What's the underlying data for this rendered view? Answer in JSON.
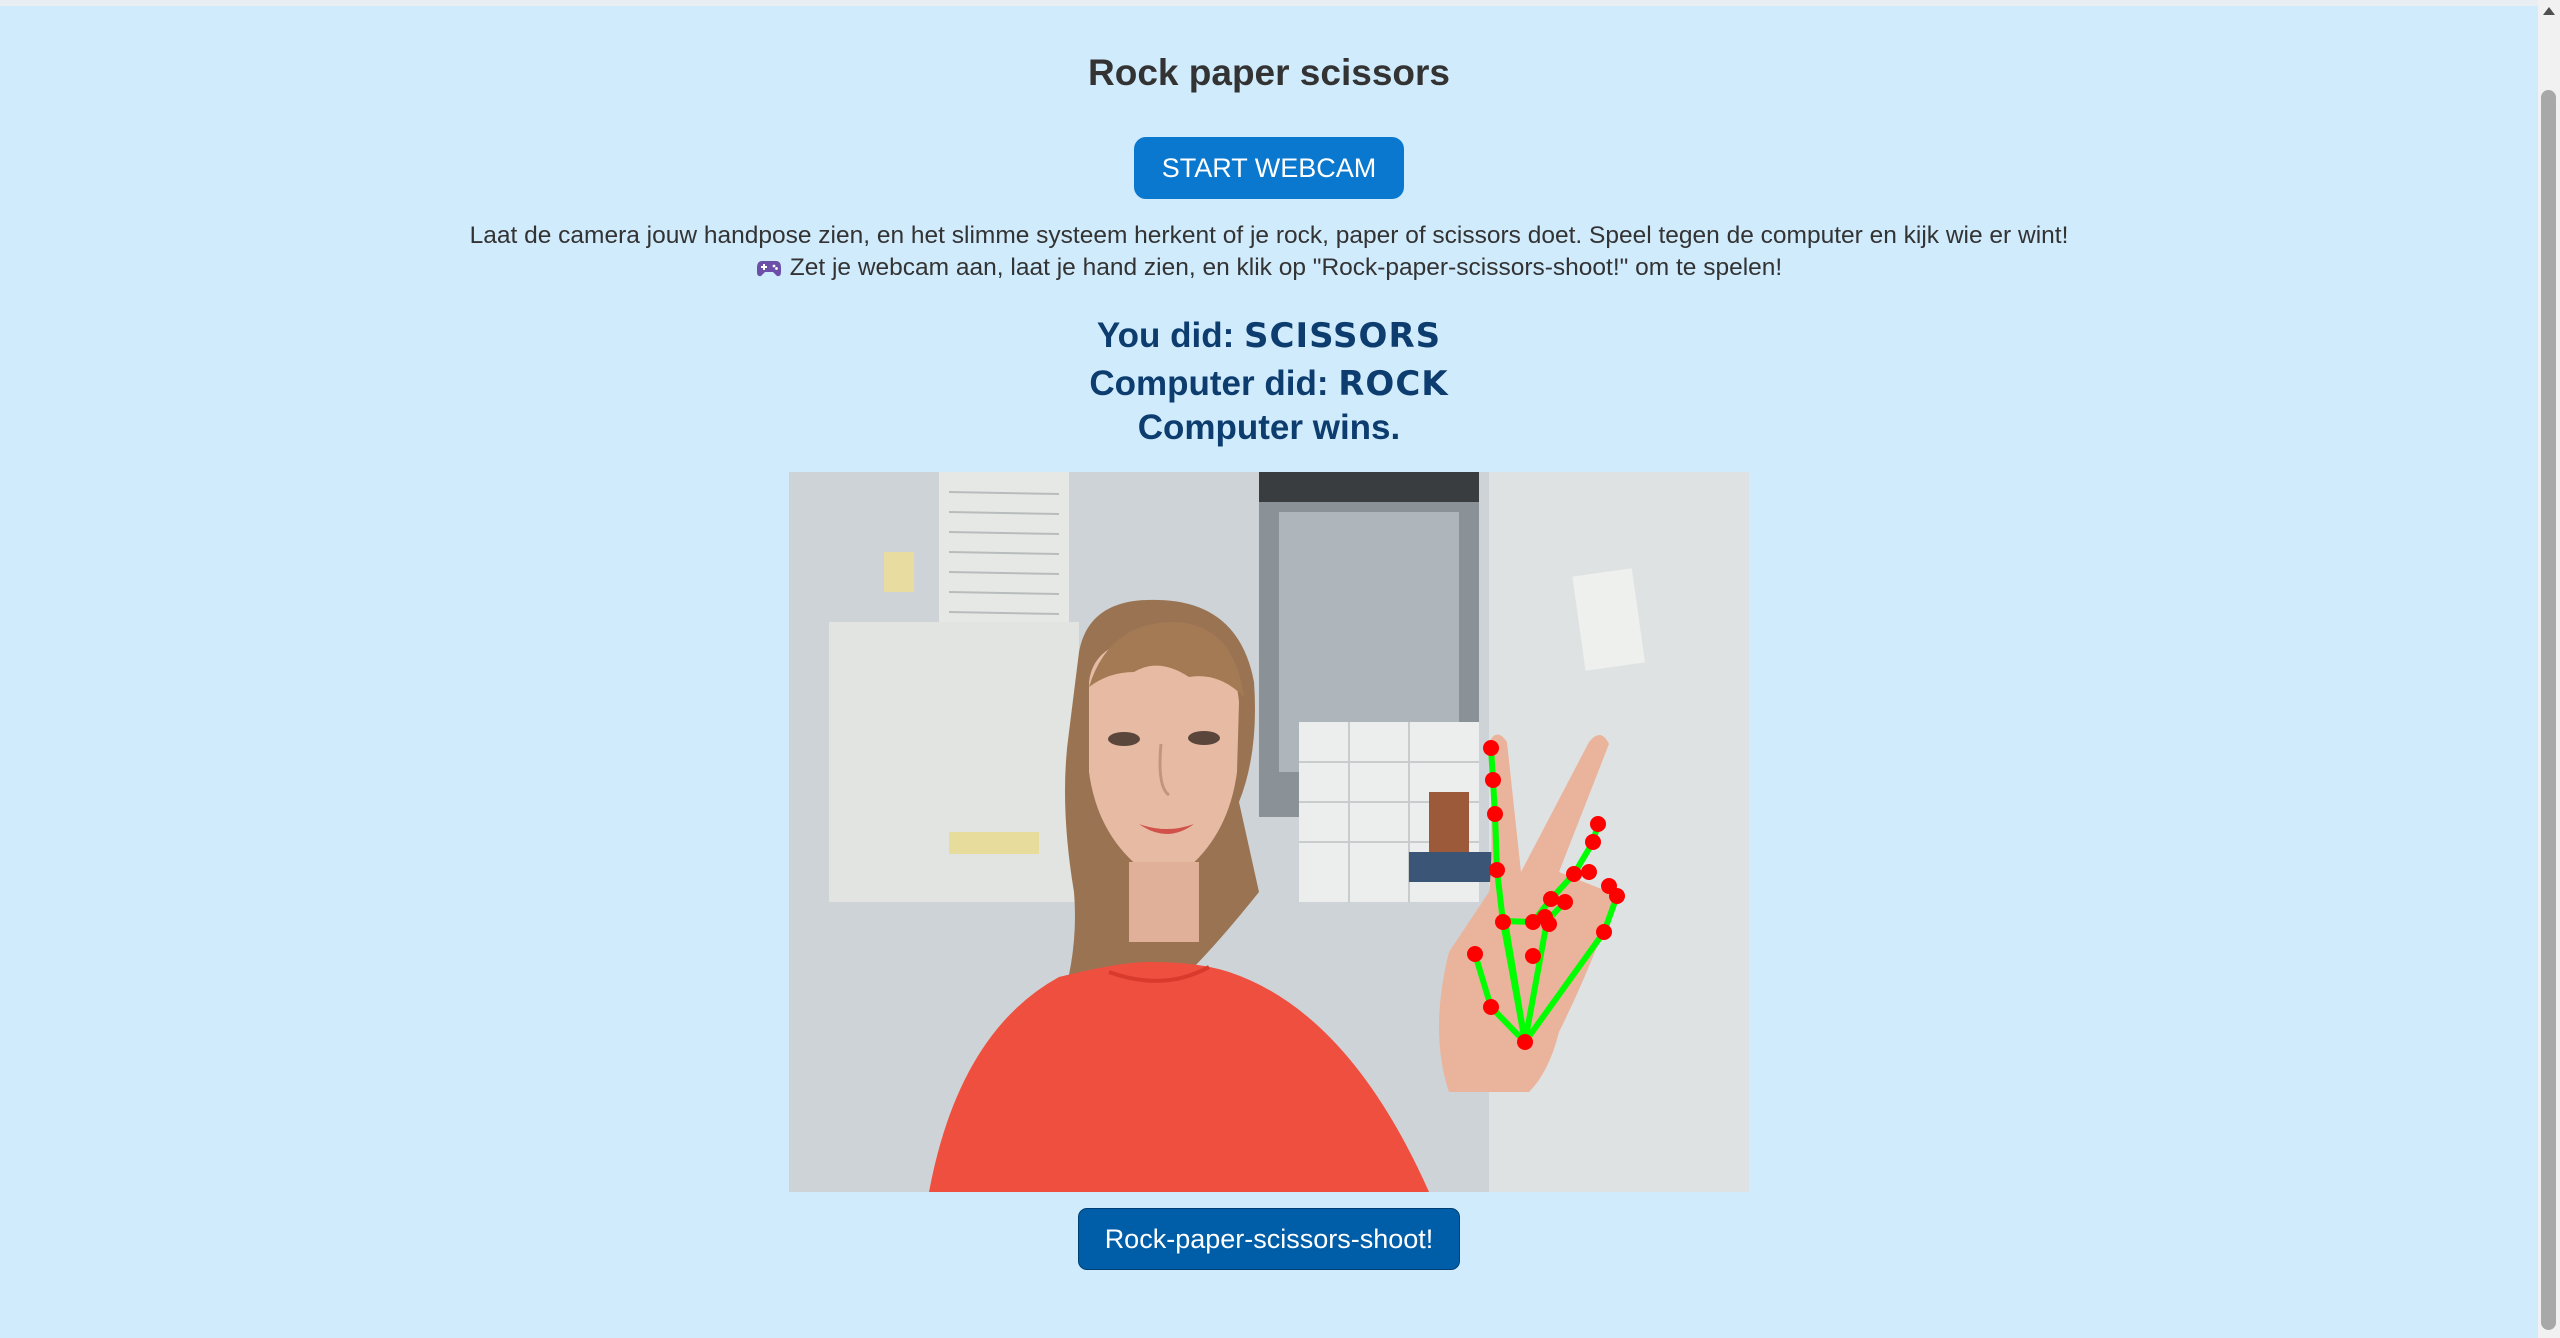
{
  "title": "Rock paper scissors",
  "start_button_label": "START WEBCAM",
  "description_line1": "Laat de camera jouw handpose zien, en het slimme systeem herkent of je rock, paper of scissors doet. Speel tegen de computer en kijk wie er wint!",
  "description_line2": "Zet je webcam aan, laat je hand zien, en klik op \"Rock-paper-scissors-shoot!\" om te spelen!",
  "description_icon": "gamepad-icon",
  "result": {
    "you_label": "You did:",
    "you_move": "SCISSORS",
    "computer_label": "Computer did:",
    "computer_move": "ROCK",
    "outcome": "Computer wins."
  },
  "shoot_button_label": "Rock-paper-scissors-shoot!",
  "colors": {
    "background": "#d0ebfc",
    "primary_button": "#0a78cf",
    "shoot_button": "#005ea8",
    "result_text": "#0d3c6e",
    "landmark_point": "#ff0000",
    "landmark_line": "#00ff00"
  }
}
